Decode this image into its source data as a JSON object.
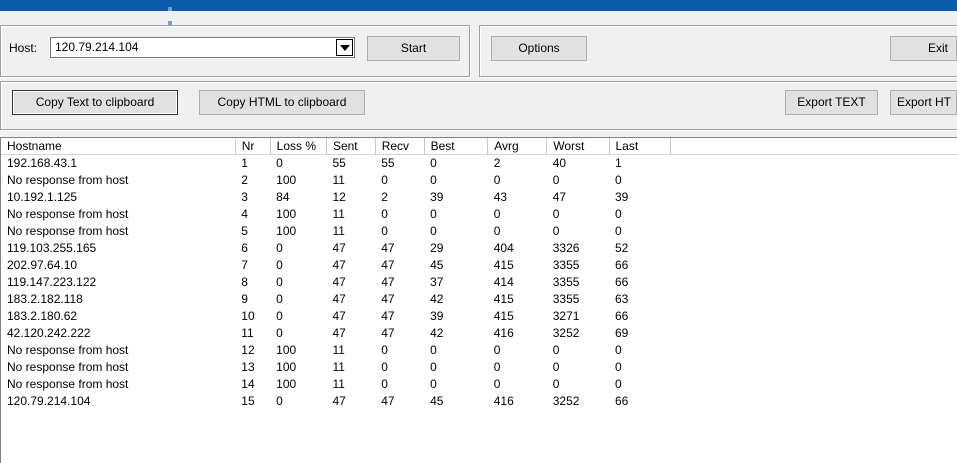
{
  "toolbar": {
    "host_label": "Host:",
    "host_value": "120.79.214.104",
    "start_label": "Start",
    "options_label": "Options",
    "exit_label": "Exit"
  },
  "actions": {
    "copy_text_label": "Copy Text to clipboard",
    "copy_html_label": "Copy HTML to clipboard",
    "export_text_label": "Export TEXT",
    "export_html_label": "Export HT"
  },
  "table": {
    "columns": [
      "Hostname",
      "Nr",
      "Loss %",
      "Sent",
      "Recv",
      "Best",
      "Avrg",
      "Worst",
      "Last"
    ],
    "rows": [
      [
        "192.168.43.1",
        "1",
        "0",
        "55",
        "55",
        "0",
        "2",
        "40",
        "1"
      ],
      [
        "No response from host",
        "2",
        "100",
        "11",
        "0",
        "0",
        "0",
        "0",
        "0"
      ],
      [
        "10.192.1.125",
        "3",
        "84",
        "12",
        "2",
        "39",
        "43",
        "47",
        "39"
      ],
      [
        "No response from host",
        "4",
        "100",
        "11",
        "0",
        "0",
        "0",
        "0",
        "0"
      ],
      [
        "No response from host",
        "5",
        "100",
        "11",
        "0",
        "0",
        "0",
        "0",
        "0"
      ],
      [
        "119.103.255.165",
        "6",
        "0",
        "47",
        "47",
        "29",
        "404",
        "3326",
        "52"
      ],
      [
        "202.97.64.10",
        "7",
        "0",
        "47",
        "47",
        "45",
        "415",
        "3355",
        "66"
      ],
      [
        "119.147.223.122",
        "8",
        "0",
        "47",
        "47",
        "37",
        "414",
        "3355",
        "66"
      ],
      [
        "183.2.182.118",
        "9",
        "0",
        "47",
        "47",
        "42",
        "415",
        "3355",
        "63"
      ],
      [
        "183.2.180.62",
        "10",
        "0",
        "47",
        "47",
        "39",
        "415",
        "3271",
        "66"
      ],
      [
        "42.120.242.222",
        "11",
        "0",
        "47",
        "47",
        "42",
        "416",
        "3252",
        "69"
      ],
      [
        "No response from host",
        "12",
        "100",
        "11",
        "0",
        "0",
        "0",
        "0",
        "0"
      ],
      [
        "No response from host",
        "13",
        "100",
        "11",
        "0",
        "0",
        "0",
        "0",
        "0"
      ],
      [
        "No response from host",
        "14",
        "100",
        "11",
        "0",
        "0",
        "0",
        "0",
        "0"
      ],
      [
        "120.79.214.104",
        "15",
        "0",
        "47",
        "47",
        "45",
        "416",
        "3252",
        "66"
      ]
    ]
  },
  "colors": {
    "titlebar": "#0b5cad",
    "window_bg": "#f0f0f0",
    "button_bg": "#e1e1e1"
  }
}
